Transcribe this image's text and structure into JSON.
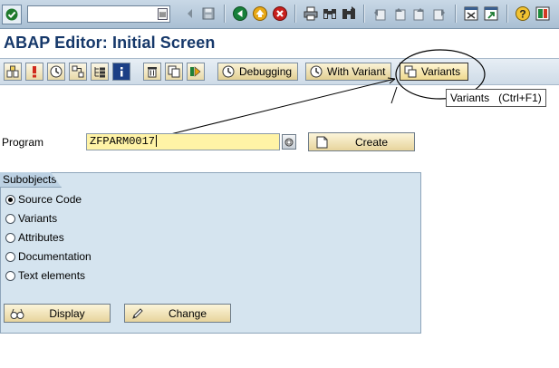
{
  "title": "ABAP Editor: Initial Screen",
  "command_field": {
    "value": ""
  },
  "system_toolbar": {
    "icons": [
      "enter-check-icon",
      "command-history-icon",
      "back-arrow-icon",
      "save-icon",
      "back-icon",
      "exit-icon",
      "cancel-icon",
      "print-icon",
      "find-icon",
      "find-next-icon",
      "first-page-icon",
      "previous-page-icon",
      "next-page-icon",
      "last-page-icon",
      "create-session-icon",
      "shortcut-icon",
      "help-icon",
      "customize-layout-icon"
    ]
  },
  "app_toolbar": {
    "icon_buttons": [
      "other-object-icon",
      "active-inactive-icon",
      "check-icon",
      "where-used-icon",
      "object-list-icon",
      "info-icon",
      "delete-icon",
      "copy-icon",
      "execute-icon"
    ],
    "debugging_label": "Debugging",
    "with_variant_label": "With Variant",
    "variants_label": "Variants"
  },
  "tooltip": "Variants   (Ctrl+F1)",
  "program": {
    "label": "Program",
    "value": "ZFPARM0017",
    "create_label": "Create"
  },
  "subobjects": {
    "title": "Subobjects",
    "options": [
      {
        "label": "Source Code",
        "selected": true
      },
      {
        "label": "Variants",
        "selected": false
      },
      {
        "label": "Attributes",
        "selected": false
      },
      {
        "label": "Documentation",
        "selected": false
      },
      {
        "label": "Text elements",
        "selected": false
      }
    ],
    "display_label": "Display",
    "change_label": "Change"
  },
  "colors": {
    "title": "#16386a",
    "group_background": "#d5e4ef",
    "input_highlight": "#fff3a6",
    "button_gold": "#e7d49c"
  }
}
